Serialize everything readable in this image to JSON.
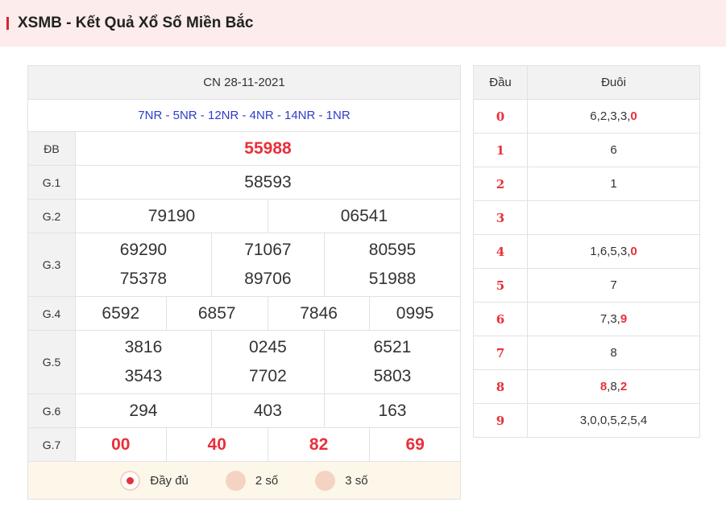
{
  "header": {
    "title": "XSMB - Kết Quả Xổ Số Miền Bắc"
  },
  "result": {
    "date": "CN 28-11-2021",
    "codes": "7NR - 5NR - 12NR - 4NR - 14NR - 1NR",
    "db": {
      "label": "ĐB",
      "value": "55988"
    },
    "g1": {
      "label": "G.1",
      "value": "58593"
    },
    "g2": {
      "label": "G.2",
      "values": [
        "79190",
        "06541"
      ]
    },
    "g3": {
      "label": "G.3",
      "values": [
        "69290",
        "75378",
        "71067",
        "89706",
        "80595",
        "51988"
      ]
    },
    "g4": {
      "label": "G.4",
      "values": [
        "6592",
        "6857",
        "7846",
        "0995"
      ]
    },
    "g5": {
      "label": "G.5",
      "values": [
        "3816",
        "3543",
        "0245",
        "7702",
        "6521",
        "5803"
      ]
    },
    "g6": {
      "label": "G.6",
      "values": [
        "294",
        "403",
        "163"
      ]
    },
    "g7": {
      "label": "G.7",
      "values": [
        "00",
        "40",
        "82",
        "69"
      ]
    }
  },
  "options": [
    {
      "label": "Đầy đủ",
      "selected": true
    },
    {
      "label": "2 số",
      "selected": false
    },
    {
      "label": "3 số",
      "selected": false
    }
  ],
  "loto": {
    "head_label": "Đầu",
    "tail_label": "Đuôi",
    "rows": [
      {
        "head": "0",
        "tails": [
          [
            "6",
            false
          ],
          [
            "2",
            false
          ],
          [
            "3",
            false
          ],
          [
            "3",
            false
          ],
          [
            "0",
            true
          ]
        ]
      },
      {
        "head": "1",
        "tails": [
          [
            "6",
            false
          ]
        ]
      },
      {
        "head": "2",
        "tails": [
          [
            "1",
            false
          ]
        ]
      },
      {
        "head": "3",
        "tails": []
      },
      {
        "head": "4",
        "tails": [
          [
            "1",
            false
          ],
          [
            "6",
            false
          ],
          [
            "5",
            false
          ],
          [
            "3",
            false
          ],
          [
            "0",
            true
          ]
        ]
      },
      {
        "head": "5",
        "tails": [
          [
            "7",
            false
          ]
        ]
      },
      {
        "head": "6",
        "tails": [
          [
            "7",
            false
          ],
          [
            "3",
            false
          ],
          [
            "9",
            true
          ]
        ]
      },
      {
        "head": "7",
        "tails": [
          [
            "8",
            false
          ]
        ]
      },
      {
        "head": "8",
        "tails": [
          [
            "8",
            true
          ],
          [
            "8",
            false
          ],
          [
            "2",
            true
          ]
        ]
      },
      {
        "head": "9",
        "tails": [
          [
            "3",
            false
          ],
          [
            "0",
            false
          ],
          [
            "0",
            false
          ],
          [
            "5",
            false
          ],
          [
            "2",
            false
          ],
          [
            "5",
            false
          ],
          [
            "4",
            false
          ]
        ]
      }
    ]
  },
  "colors": {
    "accent_red": "#e8303a",
    "code_blue": "#2d3ec9",
    "header_bg": "#fcecec",
    "options_bg": "#fdf7ea"
  }
}
